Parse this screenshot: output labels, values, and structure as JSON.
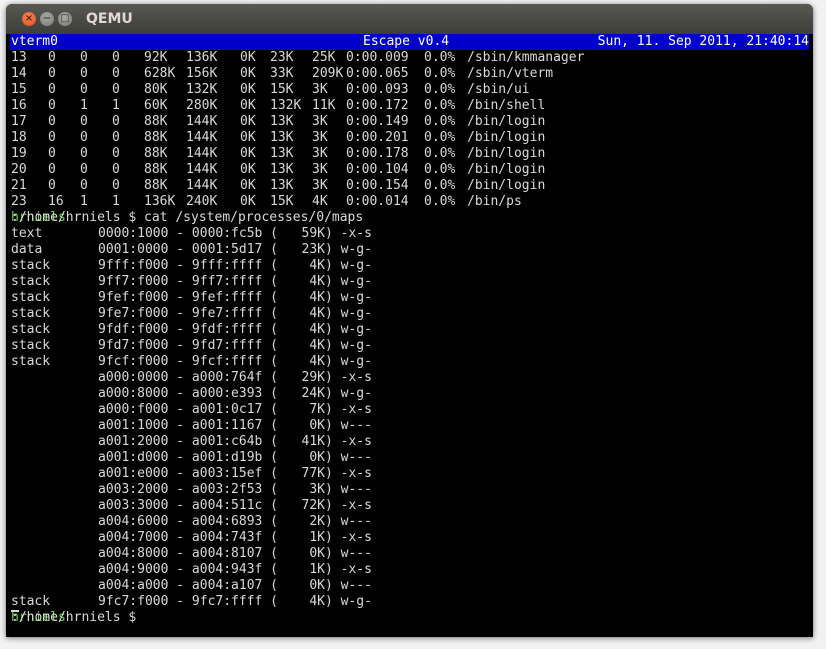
{
  "window": {
    "title": "QEMU"
  },
  "statusbar": {
    "left": "vterm0",
    "middle": "Escape v0.4",
    "right": "Sun, 11. Sep 2011, 21:40:14"
  },
  "processes": [
    [
      "13",
      "0",
      "0",
      "0",
      "92K",
      "136K",
      "0K",
      "23K",
      "25K",
      "0:00.009",
      "0.0%",
      "/sbin/kmmanager"
    ],
    [
      "14",
      "0",
      "0",
      "0",
      "628K",
      "156K",
      "0K",
      "33K",
      "209K",
      "0:00.065",
      "0.0%",
      "/sbin/vterm"
    ],
    [
      "15",
      "0",
      "0",
      "0",
      "80K",
      "132K",
      "0K",
      "15K",
      "3K",
      "0:00.093",
      "0.0%",
      "/sbin/ui"
    ],
    [
      "16",
      "0",
      "1",
      "1",
      "60K",
      "280K",
      "0K",
      "132K",
      "11K",
      "0:00.172",
      "0.0%",
      "/bin/shell"
    ],
    [
      "17",
      "0",
      "0",
      "0",
      "88K",
      "144K",
      "0K",
      "13K",
      "3K",
      "0:00.149",
      "0.0%",
      "/bin/login"
    ],
    [
      "18",
      "0",
      "0",
      "0",
      "88K",
      "144K",
      "0K",
      "13K",
      "3K",
      "0:00.201",
      "0.0%",
      "/bin/login"
    ],
    [
      "19",
      "0",
      "0",
      "0",
      "88K",
      "144K",
      "0K",
      "13K",
      "3K",
      "0:00.178",
      "0.0%",
      "/bin/login"
    ],
    [
      "20",
      "0",
      "0",
      "0",
      "88K",
      "144K",
      "0K",
      "13K",
      "3K",
      "0:00.104",
      "0.0%",
      "/bin/login"
    ],
    [
      "21",
      "0",
      "0",
      "0",
      "88K",
      "144K",
      "0K",
      "13K",
      "3K",
      "0:00.154",
      "0.0%",
      "/bin/login"
    ],
    [
      "23",
      "16",
      "1",
      "1",
      "136K",
      "240K",
      "0K",
      "15K",
      "4K",
      "0:00.014",
      "0.0%",
      "/bin/ps"
    ]
  ],
  "prompt1": {
    "user": "hrniels",
    "rest": ":/home/hrniels $ cat /system/processes/0/maps"
  },
  "maps": [
    [
      "text",
      "0000:1000 - 0000:fc5b (   59K) -x-s"
    ],
    [
      "data",
      "0001:0000 - 0001:5d17 (   23K) w-g-"
    ],
    [
      "stack",
      "9fff:f000 - 9fff:ffff (    4K) w-g-"
    ],
    [
      "stack",
      "9ff7:f000 - 9ff7:ffff (    4K) w-g-"
    ],
    [
      "stack",
      "9fef:f000 - 9fef:ffff (    4K) w-g-"
    ],
    [
      "stack",
      "9fe7:f000 - 9fe7:ffff (    4K) w-g-"
    ],
    [
      "stack",
      "9fdf:f000 - 9fdf:ffff (    4K) w-g-"
    ],
    [
      "stack",
      "9fd7:f000 - 9fd7:ffff (    4K) w-g-"
    ],
    [
      "stack",
      "9fcf:f000 - 9fcf:ffff (    4K) w-g-"
    ],
    [
      "",
      "a000:0000 - a000:764f (   29K) -x-s"
    ],
    [
      "",
      "a000:8000 - a000:e393 (   24K) w-g-"
    ],
    [
      "",
      "a000:f000 - a001:0c17 (    7K) -x-s"
    ],
    [
      "",
      "a001:1000 - a001:1167 (    0K) w---"
    ],
    [
      "",
      "a001:2000 - a001:c64b (   41K) -x-s"
    ],
    [
      "",
      "a001:d000 - a001:d19b (    0K) w---"
    ],
    [
      "",
      "a001:e000 - a003:15ef (   77K) -x-s"
    ],
    [
      "",
      "a003:2000 - a003:2f53 (    3K) w---"
    ],
    [
      "",
      "a003:3000 - a004:511c (   72K) -x-s"
    ],
    [
      "",
      "a004:6000 - a004:6893 (    2K) w---"
    ],
    [
      "",
      "a004:7000 - a004:743f (    1K) -x-s"
    ],
    [
      "",
      "a004:8000 - a004:8107 (    0K) w---"
    ],
    [
      "",
      "a004:9000 - a004:943f (    1K) -x-s"
    ],
    [
      "",
      "a004:a000 - a004:a107 (    0K) w---"
    ],
    [
      "stack",
      "9fc7:f000 - 9fc7:ffff (    4K) w-g-"
    ]
  ],
  "prompt2": {
    "user": "hrniels",
    "rest": ":/home/hrniels $ "
  },
  "colors": {
    "statusbar_bg": "#0000c8",
    "prompt_user": "#66d93d",
    "terminal_bg": "#000000",
    "terminal_fg": "#d9d9d9"
  }
}
